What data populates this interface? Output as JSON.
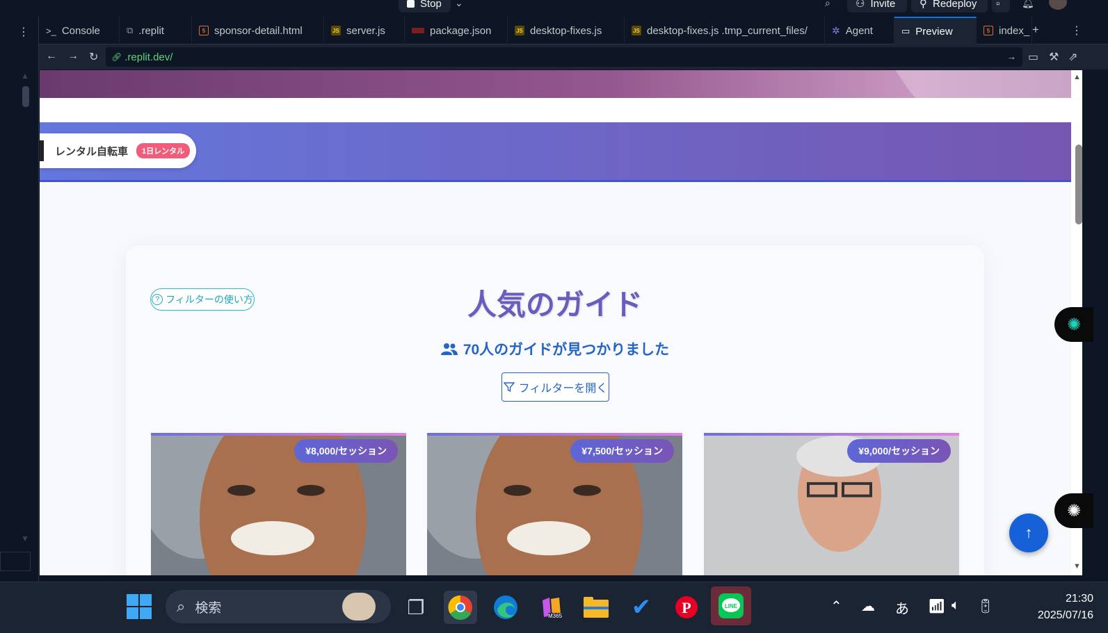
{
  "topbar": {
    "run_label": "Stop",
    "invite_label": "Invite",
    "redeploy_label": "Redeploy"
  },
  "tabs": [
    {
      "label": "Console",
      "icon": "terminal-icon"
    },
    {
      "label": ".replit",
      "icon": "replit-file-icon"
    },
    {
      "label": "sponsor-detail.html",
      "icon": "html-file-icon"
    },
    {
      "label": "server.js",
      "icon": "js-file-icon"
    },
    {
      "label": "package.json",
      "icon": "json-file-icon"
    },
    {
      "label": "desktop-fixes.js",
      "icon": "js-file-icon"
    },
    {
      "label": "desktop-fixes.js .tmp_current_files/",
      "icon": "js-file-icon"
    },
    {
      "label": "Agent",
      "icon": "agent-icon"
    },
    {
      "label": "Preview",
      "icon": "monitor-icon"
    },
    {
      "label": "index_",
      "icon": "html-file-icon"
    }
  ],
  "address": {
    "url": ".replit.dev/"
  },
  "page": {
    "category": {
      "label": "レンタル自転車",
      "badge": "1日レンタル"
    },
    "filter_help": "フィルターの使い方",
    "title": "人気のガイド",
    "count_text": "70人のガイドが見つかりました",
    "filter_open": "フィルターを開く",
    "guides": [
      {
        "price": "¥8,000/セッション"
      },
      {
        "price": "¥7,500/セッション"
      },
      {
        "price": "¥9,000/セッション"
      }
    ]
  },
  "taskbar": {
    "search_placeholder": "検索",
    "ime": "あ",
    "time": "21:30",
    "date": "2025/07/16",
    "copilot_badge": "M365"
  },
  "colors": {
    "accent": "#6a5cbf",
    "link": "#2464c9",
    "teal": "#1ba6bd",
    "badge": "#ef5d7b"
  }
}
